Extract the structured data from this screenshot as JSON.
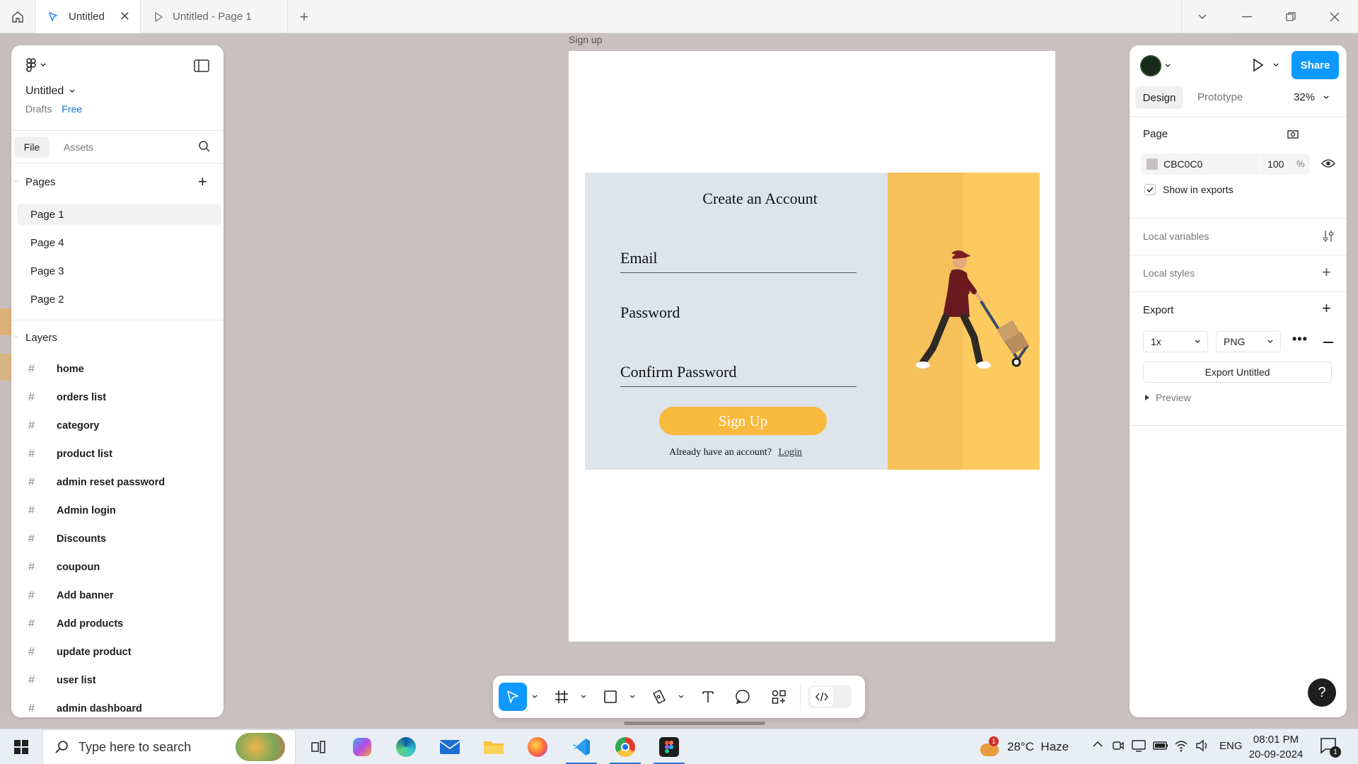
{
  "tabs": [
    {
      "label": "Untitled",
      "active": true
    },
    {
      "label": "Untitled - Page 1",
      "active": false
    }
  ],
  "canvas": {
    "bg": "#CBC0C0",
    "frame_label": "Sign up"
  },
  "left_panel": {
    "file_name": "Untitled",
    "drafts": "Drafts",
    "plan": "Free",
    "tab_file": "File",
    "tab_assets": "Assets",
    "pages_title": "Pages",
    "pages": [
      "Page 1",
      "Page 4",
      "Page 3",
      "Page 2"
    ],
    "layers_title": "Layers",
    "layers": [
      "home",
      "orders list",
      "category",
      "product list",
      "admin reset password",
      "Admin login",
      "Discounts",
      "coupoun",
      "Add banner",
      "Add products",
      "update product",
      "user list",
      "admin dashboard"
    ]
  },
  "design": {
    "title": "Create an  Account",
    "email": "Email",
    "password": "Password",
    "confirm": "Confirm Password",
    "button": "Sign Up",
    "footer": "Already have an account?",
    "login": "Login",
    "card_bg": "#DDE4EA",
    "accent": "#F8B93C"
  },
  "right_panel": {
    "share": "Share",
    "tab_design": "Design",
    "tab_prototype": "Prototype",
    "zoom": "32%",
    "page_title": "Page",
    "page_color": "CBC0C0",
    "page_opacity": "100",
    "pct": "%",
    "show_exports": "Show in exports",
    "local_variables": "Local variables",
    "local_styles": "Local styles",
    "export_title": "Export",
    "export_scale": "1x",
    "export_format": "PNG",
    "export_button": "Export Untitled",
    "preview": "Preview"
  },
  "help": "?",
  "taskbar": {
    "search_placeholder": "Type here to search",
    "weather": "28°C  Haze",
    "weather_badge": "1",
    "lang": "ENG",
    "time": "08:01 PM",
    "date": "20-09-2024",
    "notif": "1"
  }
}
